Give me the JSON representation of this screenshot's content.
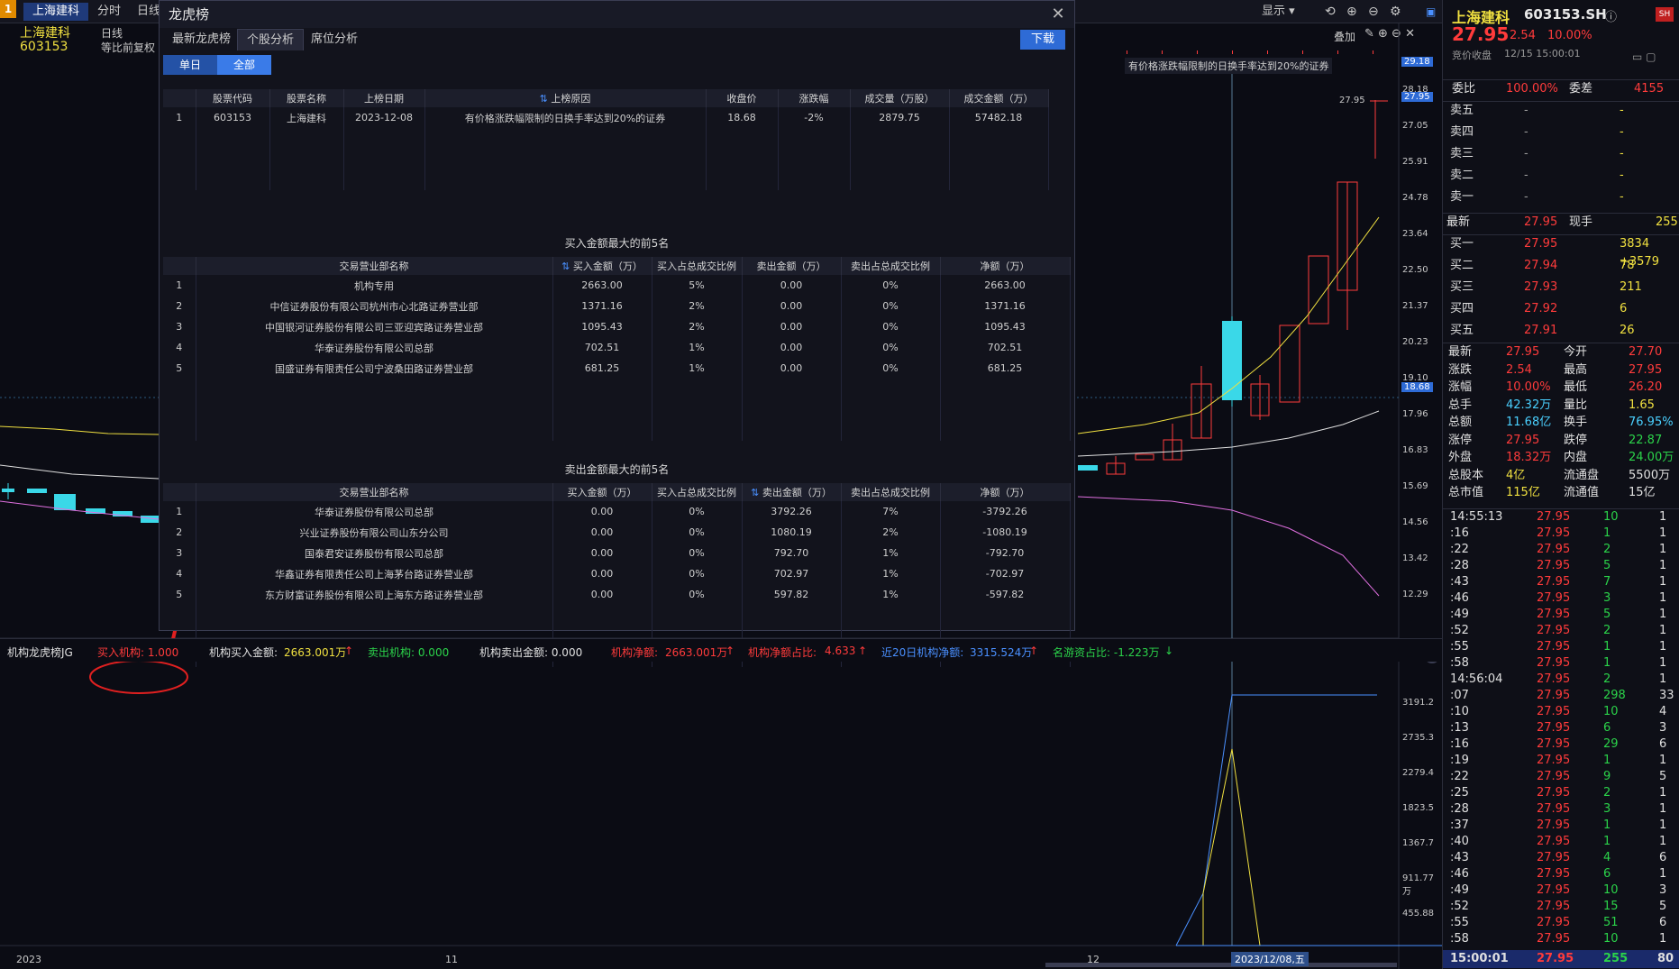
{
  "topbar": {
    "badge": "1",
    "tabs": [
      "上海建科",
      "分时",
      "日线"
    ],
    "display_label": "显示",
    "overlay_label": "叠加"
  },
  "stock": {
    "name": "上海建科",
    "code": "603153",
    "period": "日线",
    "adjust": "等比前复权"
  },
  "price_axis": [
    "28.18",
    "27.05",
    "25.91",
    "24.78",
    "23.64",
    "22.50",
    "21.37",
    "20.23",
    "19.10",
    "17.96",
    "16.83",
    "15.69",
    "14.56",
    "13.42",
    "12.29"
  ],
  "price_axis_tags": {
    "top": "29.18",
    "current": "27.95",
    "close_line": "18.68"
  },
  "chart_annotations": {
    "high_label": "27.95",
    "reason_banner": "有价格涨跌幅限制的日换手率达到20%的证券"
  },
  "lower_axis": [
    "3191.2",
    "2735.3",
    "2279.4",
    "1823.5",
    "1367.7",
    "911.77万",
    "455.88"
  ],
  "time_axis": {
    "a": "2023",
    "b": "11",
    "c": "12",
    "cursor": "2023/12/08,五"
  },
  "dialog": {
    "title": "龙虎榜",
    "tabs": [
      "最新龙虎榜",
      "个股分析",
      "席位分析"
    ],
    "download": "下载",
    "segments": [
      "单日",
      "全部"
    ],
    "main_table": {
      "headers": [
        "",
        "股票代码",
        "股票名称",
        "上榜日期",
        "上榜原因",
        "收盘价",
        "涨跌幅",
        "成交量（万股）",
        "成交金额（万）"
      ],
      "rows": [
        [
          "1",
          "603153",
          "上海建科",
          "2023-12-08",
          "有价格涨跌幅限制的日换手率达到20%的证券",
          "18.68",
          "-2%",
          "2879.75",
          "57482.18"
        ]
      ]
    },
    "buy_title": "买入金额最大的前5名",
    "sell_title": "卖出金额最大的前5名",
    "detail_headers": [
      "",
      "交易营业部名称",
      "买入金额（万）",
      "买入占总成交比例",
      "卖出金额（万）",
      "卖出占总成交比例",
      "净额（万）"
    ],
    "buy_rows": [
      [
        "1",
        "机构专用",
        "2663.00",
        "5%",
        "0.00",
        "0%",
        "2663.00"
      ],
      [
        "2",
        "中信证券股份有限公司杭州市心北路证券营业部",
        "1371.16",
        "2%",
        "0.00",
        "0%",
        "1371.16"
      ],
      [
        "3",
        "中国银河证券股份有限公司三亚迎宾路证券营业部",
        "1095.43",
        "2%",
        "0.00",
        "0%",
        "1095.43"
      ],
      [
        "4",
        "华泰证券股份有限公司总部",
        "702.51",
        "1%",
        "0.00",
        "0%",
        "702.51"
      ],
      [
        "5",
        "国盛证券有限责任公司宁波桑田路证券营业部",
        "681.25",
        "1%",
        "0.00",
        "0%",
        "681.25"
      ]
    ],
    "sell_rows": [
      [
        "1",
        "华泰证券股份有限公司总部",
        "0.00",
        "0%",
        "3792.26",
        "7%",
        "-3792.26"
      ],
      [
        "2",
        "兴业证券股份有限公司山东分公司",
        "0.00",
        "0%",
        "1080.19",
        "2%",
        "-1080.19"
      ],
      [
        "3",
        "国泰君安证券股份有限公司总部",
        "0.00",
        "0%",
        "792.70",
        "1%",
        "-792.70"
      ],
      [
        "4",
        "华鑫证券有限责任公司上海茅台路证券营业部",
        "0.00",
        "0%",
        "702.97",
        "1%",
        "-702.97"
      ],
      [
        "5",
        "东方财富证券股份有限公司上海东方路证券营业部",
        "0.00",
        "0%",
        "597.82",
        "1%",
        "-597.82"
      ]
    ]
  },
  "indicator_bar": {
    "name": "机构龙虎榜JG",
    "buy_inst": "买入机构: 1.000",
    "buy_amount_label": "机构买入金额:",
    "buy_amount": "2663.001万",
    "sell_inst": "卖出机构: 0.000",
    "sell_amount": "机构卖出金额: 0.000",
    "net_label": "机构净额:",
    "net": "2663.001万",
    "net_ratio_label": "机构净额占比:",
    "net_ratio": "4.633",
    "net20_label": "近20日机构净额:",
    "net20": "3315.524万",
    "famous": "名游资占比: -1.223万"
  },
  "right_panel": {
    "name": "上海建科",
    "code": "603153.SH",
    "price": "27.95",
    "change": "2.54",
    "pct": "10.00%",
    "close_label": "竞价收盘",
    "close_time": "12/15  15:00:01",
    "weibi_label": "委比",
    "weibi": "100.00%",
    "weicha_label": "委差",
    "weicha": "4155",
    "sells": [
      [
        "卖五",
        "-",
        "-"
      ],
      [
        "卖四",
        "-",
        "-"
      ],
      [
        "卖三",
        "-",
        "-"
      ],
      [
        "卖二",
        "-",
        "-"
      ],
      [
        "卖一",
        "-",
        "-"
      ]
    ],
    "latest_label": "最新",
    "latest": "27.95",
    "now_hand_label": "现手",
    "now_hand": "255",
    "buys": [
      [
        "买一",
        "27.95",
        "3834 +3579"
      ],
      [
        "买二",
        "27.94",
        "78"
      ],
      [
        "买三",
        "27.93",
        "211"
      ],
      [
        "买四",
        "27.92",
        "6"
      ],
      [
        "买五",
        "27.91",
        "26"
      ]
    ],
    "stats": [
      [
        "最新",
        "27.95",
        "今开",
        "27.70"
      ],
      [
        "涨跌",
        "2.54",
        "最高",
        "27.95"
      ],
      [
        "涨幅",
        "10.00%",
        "最低",
        "26.20"
      ],
      [
        "总手",
        "42.32万",
        "量比",
        "1.65"
      ],
      [
        "总额",
        "11.68亿",
        "换手",
        "76.95%"
      ],
      [
        "涨停",
        "27.95",
        "跌停",
        "22.87"
      ],
      [
        "外盘",
        "18.32万",
        "内盘",
        "24.00万"
      ],
      [
        "总股本",
        "4亿",
        "流通盘",
        "5500万"
      ],
      [
        "总市值",
        "115亿",
        "流通值",
        "15亿"
      ]
    ],
    "ticks": [
      [
        "14:55:13",
        "27.95",
        "10",
        "1"
      ],
      [
        ":16",
        "27.95",
        "1",
        "1"
      ],
      [
        ":22",
        "27.95",
        "2",
        "1"
      ],
      [
        ":28",
        "27.95",
        "5",
        "1"
      ],
      [
        ":43",
        "27.95",
        "7",
        "1"
      ],
      [
        ":46",
        "27.95",
        "3",
        "1"
      ],
      [
        ":49",
        "27.95",
        "5",
        "1"
      ],
      [
        ":52",
        "27.95",
        "2",
        "1"
      ],
      [
        ":55",
        "27.95",
        "1",
        "1"
      ],
      [
        ":58",
        "27.95",
        "1",
        "1"
      ],
      [
        "14:56:04",
        "27.95",
        "2",
        "1"
      ],
      [
        ":07",
        "27.95",
        "298",
        "33"
      ],
      [
        ":10",
        "27.95",
        "10",
        "4"
      ],
      [
        ":13",
        "27.95",
        "6",
        "3"
      ],
      [
        ":16",
        "27.95",
        "29",
        "6"
      ],
      [
        ":19",
        "27.95",
        "1",
        "1"
      ],
      [
        ":22",
        "27.95",
        "9",
        "5"
      ],
      [
        ":25",
        "27.95",
        "2",
        "1"
      ],
      [
        ":28",
        "27.95",
        "3",
        "1"
      ],
      [
        ":37",
        "27.95",
        "1",
        "1"
      ],
      [
        ":40",
        "27.95",
        "1",
        "1"
      ],
      [
        ":43",
        "27.95",
        "4",
        "6"
      ],
      [
        ":46",
        "27.95",
        "6",
        "1"
      ],
      [
        ":49",
        "27.95",
        "10",
        "3"
      ],
      [
        ":52",
        "27.95",
        "15",
        "5"
      ],
      [
        ":55",
        "27.95",
        "51",
        "6"
      ],
      [
        ":58",
        "27.95",
        "10",
        "1"
      ]
    ],
    "final_tick": [
      "15:00:01",
      "27.95",
      "255",
      "80"
    ]
  }
}
